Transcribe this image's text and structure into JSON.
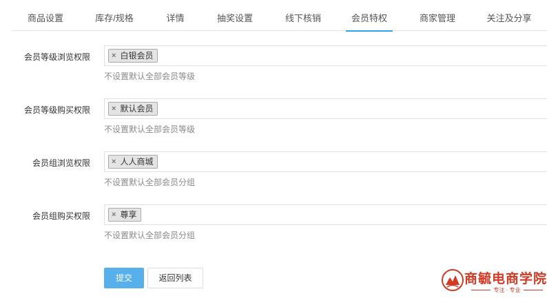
{
  "tabs": [
    {
      "label": "商品设置"
    },
    {
      "label": "库存/规格"
    },
    {
      "label": "详情"
    },
    {
      "label": "抽奖设置"
    },
    {
      "label": "线下核销"
    },
    {
      "label": "会员特权"
    },
    {
      "label": "商家管理"
    },
    {
      "label": "关注及分享"
    }
  ],
  "active_tab": "会员特权",
  "form": {
    "rows": [
      {
        "label": "会员等级浏览权限",
        "tag": "白银会员",
        "hint": "不设置默认全部会员等级"
      },
      {
        "label": "会员等级购买权限",
        "tag": "默认会员",
        "hint": "不设置默认全部会员等级"
      },
      {
        "label": "会员组浏览权限",
        "tag": "人人商城",
        "hint": "不设置默认全部会员分组"
      },
      {
        "label": "会员组购买权限",
        "tag": "尊享",
        "hint": "不设置默认全部会员分组"
      }
    ],
    "remove_glyph": "×"
  },
  "buttons": {
    "submit": "提交",
    "back": "返回列表"
  },
  "logo": {
    "name": "商毓电商学院",
    "slogan": "专注 · 专业",
    "color": "#d23a24"
  },
  "colors": {
    "accent": "#2fa3e8",
    "primary_button": "#57b0ec"
  }
}
